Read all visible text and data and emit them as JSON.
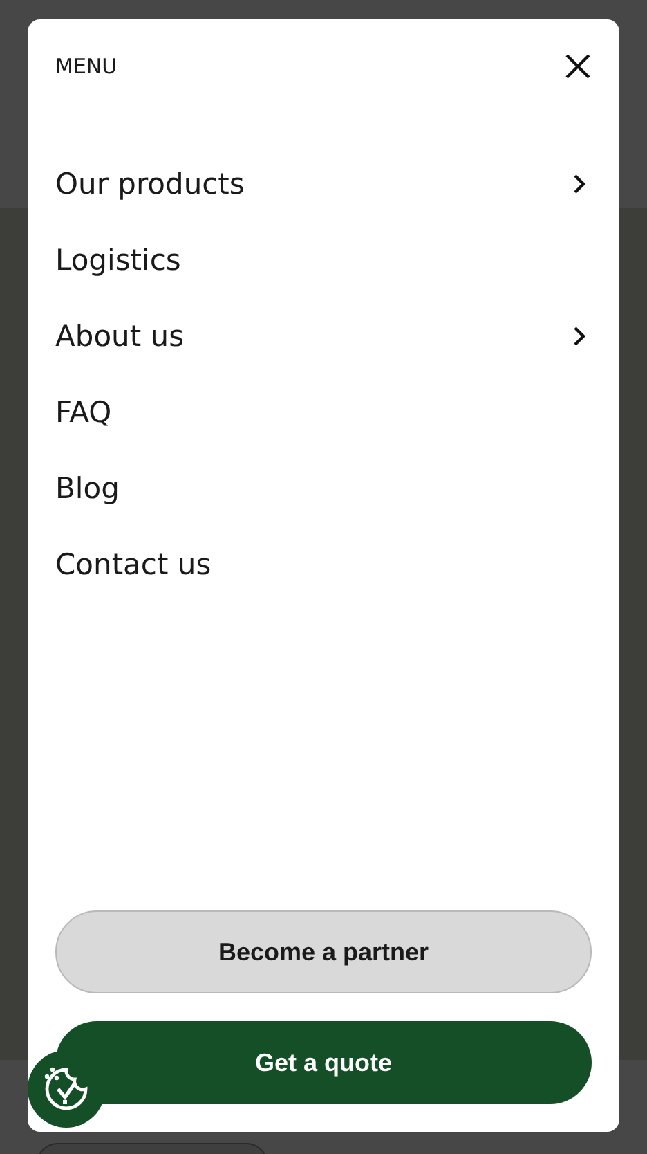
{
  "menu": {
    "title": "MENU",
    "items": [
      {
        "label": "Our products",
        "kind": "submenu"
      },
      {
        "label": "Logistics",
        "kind": "link"
      },
      {
        "label": "About us",
        "kind": "submenu"
      },
      {
        "label": "FAQ",
        "kind": "link"
      },
      {
        "label": "Blog",
        "kind": "link"
      },
      {
        "label": "Contact us",
        "kind": "link"
      }
    ],
    "buttons": [
      {
        "label": "Become a partner",
        "kind": "secondary"
      },
      {
        "label": "Get a quote",
        "kind": "primary"
      }
    ]
  }
}
